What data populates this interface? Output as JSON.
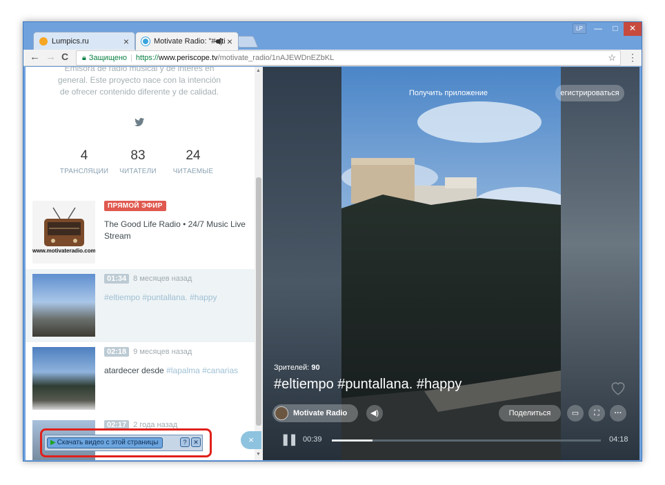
{
  "browser": {
    "tabs": [
      {
        "title": "Lumpics.ru",
        "favicon_color": "#f6a623",
        "active": false
      },
      {
        "title": "Motivate Radio: \"#elti",
        "favicon_color": "#3aa4dc",
        "active": true
      }
    ],
    "profile": "LP",
    "window_controls": {
      "minimize": "—",
      "maximize": "□",
      "close": "✕"
    },
    "nav": {
      "back": "←",
      "forward": "→",
      "reload": "C"
    },
    "security_label": "Защищено",
    "url": {
      "scheme": "https://",
      "host": "www.periscope.tv",
      "path": "/motivate_radio/1nAJEWDnEZbKL"
    }
  },
  "profile_panel": {
    "bio": "Emisora de radio musical y de interes en general. Este proyecto nace con la intención de ofrecer contenido diferente y de calidad.",
    "twitter_icon": "twitter-icon",
    "stats": [
      {
        "value": "4",
        "label": "ТРАНСЛЯЦИИ"
      },
      {
        "value": "83",
        "label": "ЧИТАТЕЛИ"
      },
      {
        "value": "24",
        "label": "ЧИТАЕМЫЕ"
      }
    ]
  },
  "broadcasts": [
    {
      "badge": "ПРЯМОЙ ЭФИР",
      "age": "",
      "title": "The Good Life Radio • 24/7 Music Live Stream",
      "tags": "",
      "thumb_caption": "www.motivateradio.com"
    },
    {
      "badge": "01:34",
      "age": "8 месяцев назад",
      "title": "",
      "tags": "#eltiempo #puntallana. #happy"
    },
    {
      "badge": "02:18",
      "age": "9 месяцев назад",
      "title": "atardecer desde",
      "tags": "#lapalma #canarias"
    },
    {
      "badge": "02:17",
      "age": "2 года назад",
      "title": "",
      "tags": ""
    }
  ],
  "download_helper": {
    "label": "Скачать видео с этой страницы",
    "help": "?",
    "close": "✕"
  },
  "panel_close": "×",
  "player": {
    "get_app": "Получить приложение",
    "register": "егистрироваться",
    "viewers_label": "Зрителей:",
    "viewers_count": "90",
    "title": "#eltiempo #puntallana. #happy",
    "user": "Motivate Radio",
    "share": "Поделиться",
    "elapsed": "00:39",
    "total": "04:18",
    "progress": 0.15
  }
}
